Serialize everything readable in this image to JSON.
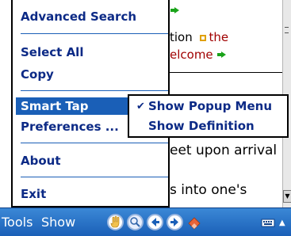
{
  "document": {
    "line1_suffix": "tion",
    "line1_link": "the",
    "line2": "elcome",
    "line3": "eet upon arrival",
    "line4": "s into one's"
  },
  "menu": {
    "items": [
      {
        "label": "Advanced Search"
      },
      {
        "label": "Select All"
      },
      {
        "label": "Copy"
      },
      {
        "label": "Smart Tap",
        "selected": true
      },
      {
        "label": "Preferences ..."
      },
      {
        "label": "About"
      },
      {
        "label": "Exit"
      }
    ]
  },
  "submenu": {
    "items": [
      {
        "label": "Show Popup Menu",
        "checked": true
      },
      {
        "label": "Show Definition",
        "checked": false
      }
    ]
  },
  "toolbar": {
    "tools_label": "Tools",
    "show_label": "Show",
    "icons": [
      "hand-icon",
      "search-text-icon",
      "back-icon",
      "forward-icon",
      "eraser-icon",
      "keyboard-icon"
    ]
  },
  "colors": {
    "menu_text": "#0c2a86",
    "highlight": "#1a5fb7",
    "toolbar": "#2b75c9",
    "link_red": "#a00000"
  }
}
